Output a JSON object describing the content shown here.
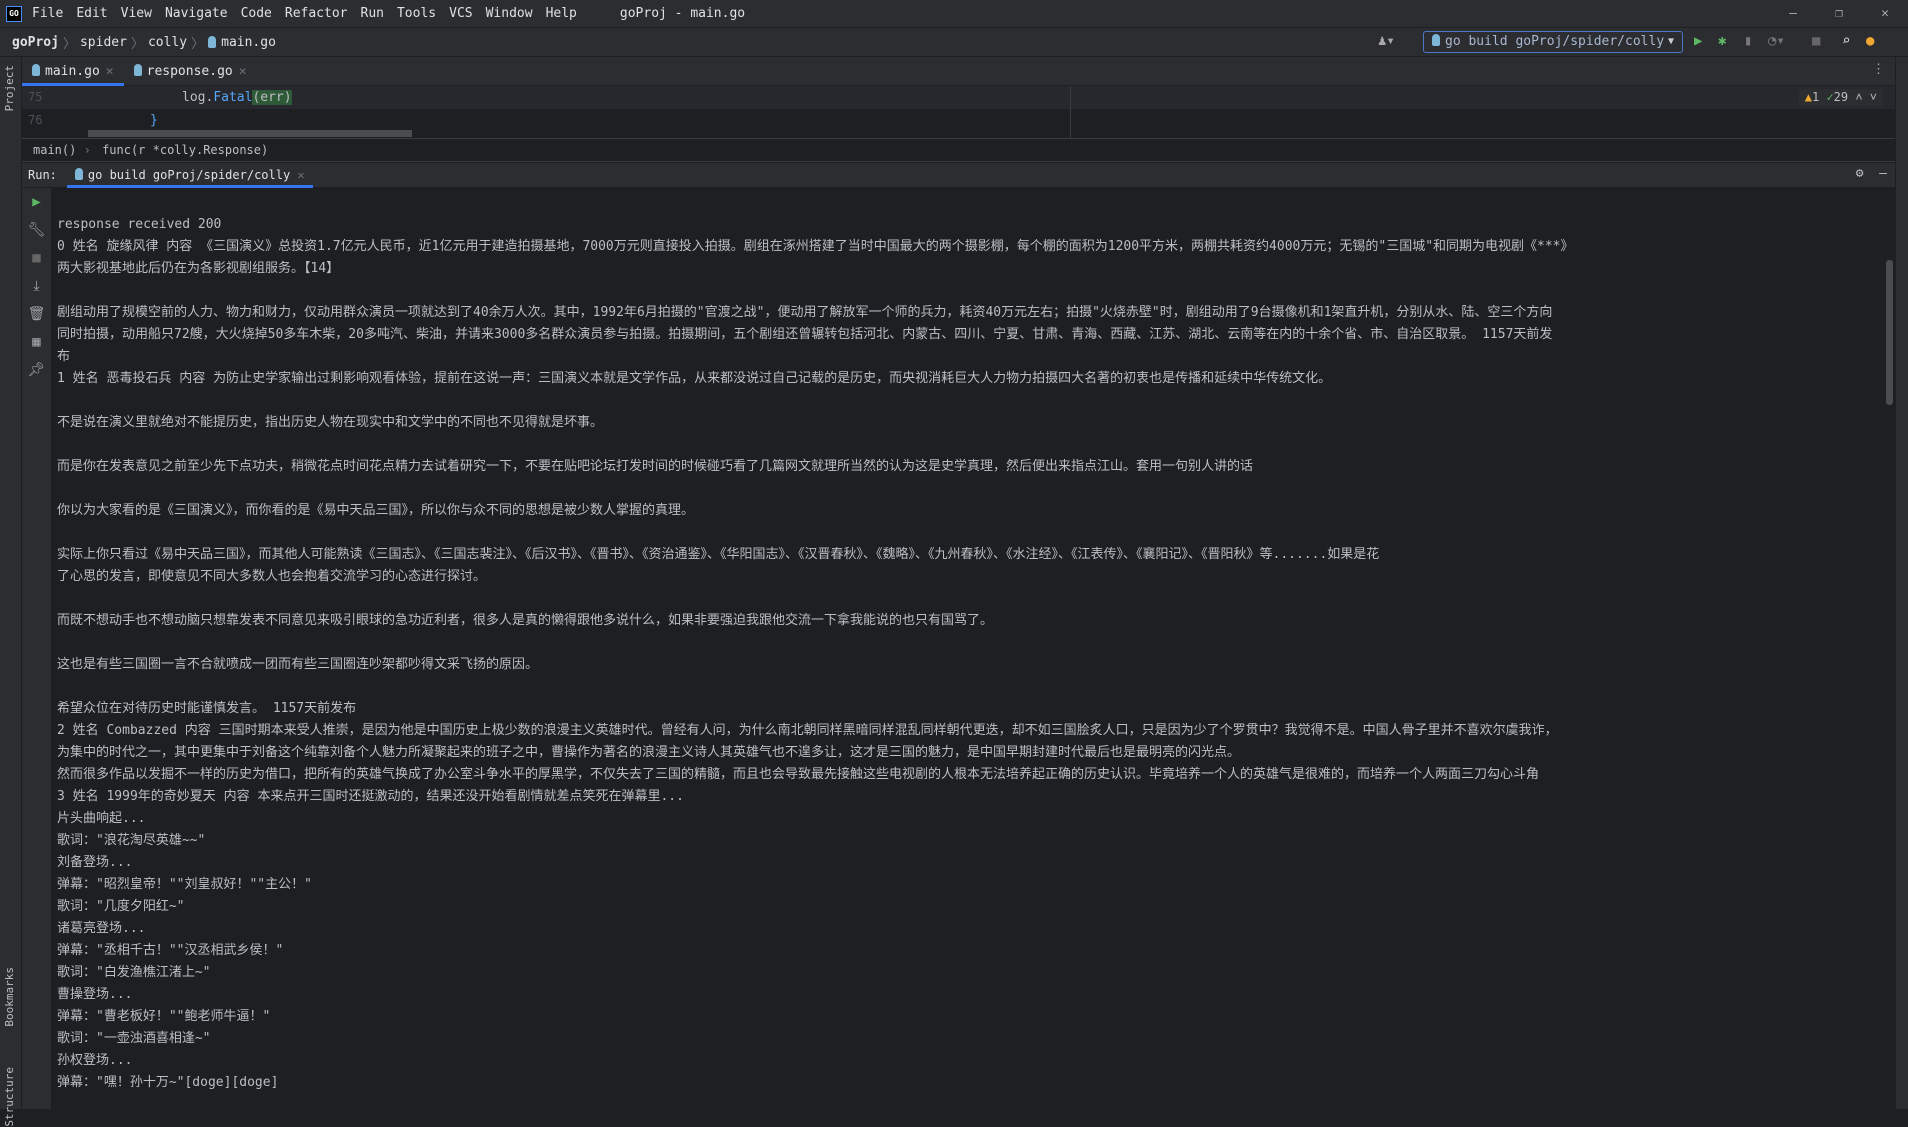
{
  "titlebar": {
    "logo": "GO",
    "menu": [
      "File",
      "Edit",
      "View",
      "Navigate",
      "Code",
      "Refactor",
      "Run",
      "Tools",
      "VCS",
      "Window",
      "Help"
    ],
    "title": "goProj - main.go"
  },
  "navbar": {
    "breadcrumb": [
      "goProj",
      "spider",
      "colly",
      "main.go"
    ],
    "run_config": "go build goProj/spider/colly"
  },
  "tabs": [
    {
      "label": "main.go",
      "active": true
    },
    {
      "label": "response.go",
      "active": false
    }
  ],
  "editor": {
    "lines": [
      {
        "num": "75",
        "code_pkg": "log.",
        "code_fn": "Fatal",
        "code_arg": "(err)"
      },
      {
        "num": "76",
        "code": "}"
      }
    ],
    "warnings": "1",
    "weak_warnings": "29"
  },
  "code_breadcrumb": [
    "main()",
    "func(r *colly.Response)"
  ],
  "run": {
    "label": "Run:",
    "tab": "go build goProj/spider/colly"
  },
  "side_labels": {
    "project": "Project",
    "bookmarks": "Bookmarks",
    "structure": "Structure"
  },
  "console": {
    "lines": [
      "response received 200",
      "0 姓名 旋缘风律 内容 《三国演义》总投资1.7亿元人民币，近1亿元用于建造拍摄基地，7000万元则直接投入拍摄。剧组在涿州搭建了当时中国最大的两个摄影棚，每个棚的面积为1200平方米，两棚共耗资约4000万元；无锡的\"三国城\"和同期为电视剧《***》",
      "两大影视基地此后仍在为各影视剧组服务。【14】",
      "",
      "剧组动用了规模空前的人力、物力和财力，仅动用群众演员一项就达到了40余万人次。其中，1992年6月拍摄的\"官渡之战\"，便动用了解放军一个师的兵力，耗资40万元左右；拍摄\"火烧赤壁\"时，剧组动用了9台摄像机和1架直升机，分别从水、陆、空三个方向",
      "同时拍摄，动用船只72艘，大火烧掉50多车木柴，20多吨汽、柴油，并请来3000多名群众演员参与拍摄。拍摄期间，五个剧组还曾辗转包括河北、内蒙古、四川、宁夏、甘肃、青海、西藏、江苏、湖北、云南等在内的十余个省、市、自治区取景。 1157天前发",
      "布",
      "1 姓名 恶毒投石兵 内容 为防止史学家输出过剩影响观看体验，提前在这说一声：三国演义本就是文学作品，从来都没说过自己记载的是历史，而央视消耗巨大人力物力拍摄四大名著的初衷也是传播和延续中华传统文化。",
      "",
      "不是说在演义里就绝对不能提历史，指出历史人物在现实中和文学中的不同也不见得就是坏事。",
      "",
      "而是你在发表意见之前至少先下点功夫，稍微花点时间花点精力去试着研究一下，不要在贴吧论坛打发时间的时候碰巧看了几篇网文就理所当然的认为这是史学真理，然后便出来指点江山。套用一句别人讲的话",
      "",
      "你以为大家看的是《三国演义》，而你看的是《易中天品三国》，所以你与众不同的思想是被少数人掌握的真理。",
      "",
      "实际上你只看过《易中天品三国》，而其他人可能熟读《三国志》、《三国志裴注》、《后汉书》、《晋书》、《资治通鉴》、《华阳国志》、《汉晋春秋》、《魏略》、《九州春秋》、《水注经》、《江表传》、《襄阳记》、《晋阳秋》等.......如果是花",
      "了心思的发言，即使意见不同大多数人也会抱着交流学习的心态进行探讨。",
      "",
      "而既不想动手也不想动脑只想靠发表不同意见来吸引眼球的急功近利者，很多人是真的懒得跟他多说什么，如果非要强迫我跟他交流一下拿我能说的也只有国骂了。",
      "",
      "这也是有些三国圈一言不合就喷成一团而有些三国圈连吵架都吵得文采飞扬的原因。",
      "",
      "希望众位在对待历史时能谨慎发言。 1157天前发布",
      "2 姓名 Combazzed 内容 三国时期本来受人推崇，是因为他是中国历史上极少数的浪漫主义英雄时代。曾经有人问，为什么南北朝同样黑暗同样混乱同样朝代更迭，却不如三国脍炙人口，只是因为少了个罗贯中？我觉得不是。中国人骨子里并不喜欢尔虞我诈，",
      "为集中的时代之一，其中更集中于刘备这个纯靠刘备个人魅力所凝聚起来的班子之中，曹操作为著名的浪漫主义诗人其英雄气也不遑多让，这才是三国的魅力，是中国早期封建时代最后也是最明亮的闪光点。",
      "然而很多作品以发掘不一样的历史为借口，把所有的英雄气换成了办公室斗争水平的厚黑学，不仅失去了三国的精髓，而且也会导致最先接触这些电视剧的人根本无法培养起正确的历史认识。毕竟培养一个人的英雄气是很难的，而培养一个人两面三刀勾心斗角",
      "3 姓名 1999年的奇妙夏天 内容 本来点开三国时还挺激动的，结果还没开始看剧情就差点笑死在弹幕里...",
      "片头曲响起...",
      "歌词：\"浪花淘尽英雄~~\"",
      "刘备登场...",
      "弹幕：\"昭烈皇帝！\"\"刘皇叔好！\"\"主公！\"",
      "歌词：\"几度夕阳红~\"",
      "诸葛亮登场...",
      "弹幕：\"丞相千古！\"\"汉丞相武乡侯！\"",
      "歌词：\"白发渔樵江渚上~\"",
      "曹操登场...",
      "弹幕：\"曹老板好！\"\"鲍老师牛逼！\"",
      "歌词：\"一壶浊酒喜相逢~\"",
      "孙权登场...",
      "弹幕：\"嘿！孙十万~\"[doge][doge]"
    ]
  },
  "colors": {
    "accent": "#3574f0",
    "run_green": "#5fb865",
    "warning": "#f0a732"
  }
}
